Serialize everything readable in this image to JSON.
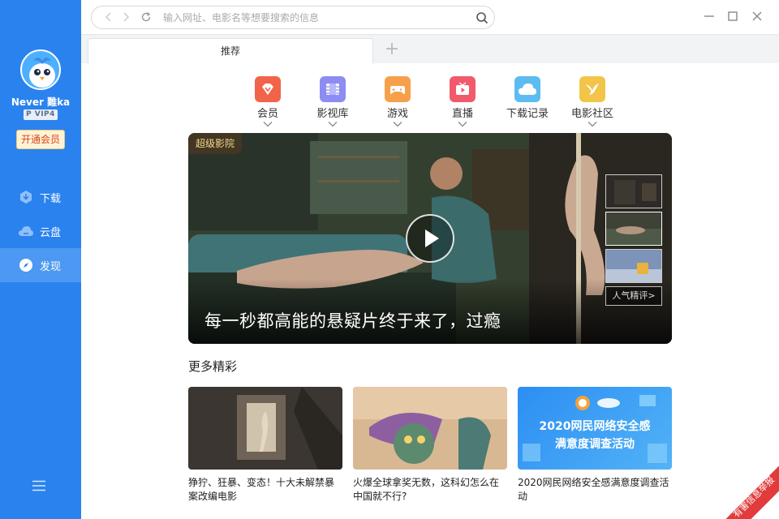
{
  "sidebar": {
    "username": "Never 難ka",
    "vip_badge": "P VIP4",
    "open_vip": "开通会员",
    "items": [
      {
        "label": "下载",
        "icon": "download-icon"
      },
      {
        "label": "云盘",
        "icon": "cloud-icon"
      },
      {
        "label": "发现",
        "icon": "compass-icon",
        "active": true
      }
    ],
    "menu_icon": "menu-icon"
  },
  "topbar": {
    "search_placeholder": "输入网址、电影名等想要搜索的信息"
  },
  "tabs": [
    {
      "label": "推荐"
    }
  ],
  "categories": [
    {
      "label": "会员",
      "icon": "vip-icon",
      "color": "#f2644a",
      "dropdown": true
    },
    {
      "label": "影视库",
      "icon": "film-icon",
      "color": "#8c8cf2",
      "dropdown": true
    },
    {
      "label": "游戏",
      "icon": "gamepad-icon",
      "color": "#f7a04b",
      "dropdown": true
    },
    {
      "label": "直播",
      "icon": "tv-icon",
      "color": "#f25a6b",
      "dropdown": true
    },
    {
      "label": "下载记录",
      "icon": "cloud-icon",
      "color": "#5cbcf2",
      "dropdown": false
    },
    {
      "label": "电影社区",
      "icon": "bird-icon",
      "color": "#f2c54a",
      "dropdown": true
    }
  ],
  "hero": {
    "tag": "超级影院",
    "title": "每一秒都高能的悬疑片终于来了，过瘾",
    "more_label": "人气精评>"
  },
  "more": {
    "title": "更多精彩",
    "cards": [
      {
        "title": "狰狞、狂暴、变态！十大未解禁暴案改编电影"
      },
      {
        "title": "火爆全球拿奖无数，这科幻怎么在中国就不行?"
      },
      {
        "title": "2020网民网络安全感满意度调查活动",
        "banner_line1": "2020网民网络安全感",
        "banner_line2": "满意度调查活动"
      }
    ]
  },
  "report": "有害信息举报",
  "colors": {
    "sidebar": "#2a82ef",
    "sidebar_active": "#4d98f2"
  }
}
